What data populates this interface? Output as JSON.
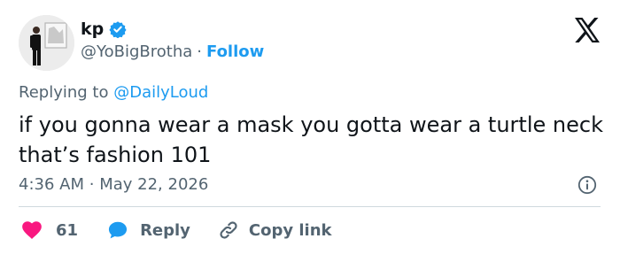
{
  "author": {
    "name": "kp",
    "handle": "@YoBigBrotha",
    "separator": "·",
    "follow_label": "Follow",
    "avatar": "person-standing-beside-framed-art"
  },
  "reply_context": {
    "prefix": "Replying to ",
    "mention": "@DailyLoud"
  },
  "tweet": {
    "text": "if you gonna wear a mask you gotta wear a turtle neck that’s fashion 101",
    "time": "4:36 AM",
    "separator": "·",
    "date": "May 22, 2026"
  },
  "actions": {
    "likes": "61",
    "reply_label": "Reply",
    "copy_label": "Copy link"
  },
  "icons": {
    "verified": "verified-badge-icon",
    "brand": "x-logo-icon",
    "info": "info-icon",
    "like": "heart-icon",
    "reply": "speech-bubble-icon",
    "copy": "link-icon"
  },
  "colors": {
    "accent": "#1d9bf0",
    "like": "#f91880",
    "text": "#0f1419",
    "muted": "#536471",
    "divider": "#cfd9de"
  }
}
